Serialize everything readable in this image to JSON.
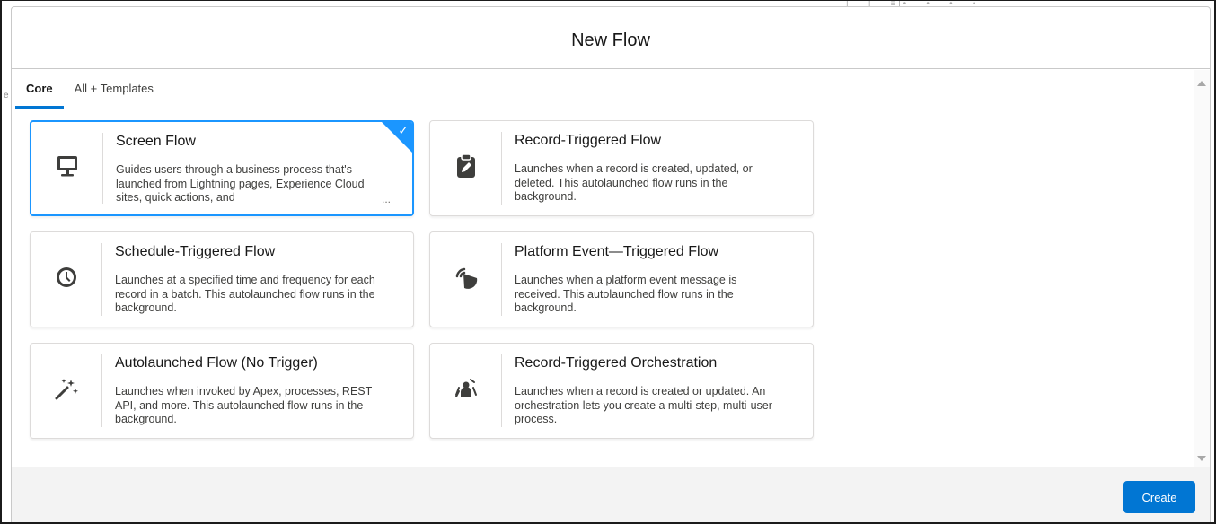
{
  "background": {
    "top_strip": "|  ___  |  ___  ≡  |  •  ___  •  ___  •  ___  •",
    "left_char": "e"
  },
  "modal": {
    "title": "New Flow"
  },
  "tabs": [
    {
      "label": "Core",
      "active": true
    },
    {
      "label": "All + Templates",
      "active": false
    }
  ],
  "cards": [
    {
      "title": "Screen Flow",
      "description": "Guides users through a business process that's launched from Lightning pages, Experience Cloud sites, quick actions, and",
      "ellipsis": "...",
      "icon": "monitor-icon",
      "selected": true
    },
    {
      "title": "Record-Triggered Flow",
      "description": "Launches when a record is created, updated, or deleted. This autolaunched flow runs in the background.",
      "icon": "clipboard-edit-icon",
      "selected": false
    },
    {
      "title": "Schedule-Triggered Flow",
      "description": "Launches at a specified time and frequency for each record in a batch. This autolaunched flow runs in the background.",
      "icon": "clock-icon",
      "selected": false
    },
    {
      "title": "Platform Event—Triggered Flow",
      "description": "Launches when a platform event message is received. This autolaunched flow runs in the background.",
      "icon": "broadcast-icon",
      "selected": false
    },
    {
      "title": "Autolaunched Flow (No Trigger)",
      "description": "Launches when invoked by Apex, processes, REST API, and more. This autolaunched flow runs in the background.",
      "icon": "magic-wand-icon",
      "selected": false
    },
    {
      "title": "Record-Triggered Orchestration",
      "description": "Launches when a record is created or updated. An orchestration lets you create a multi-step, multi-user process.",
      "icon": "orchestration-icon",
      "selected": false
    }
  ],
  "footer": {
    "create_label": "Create"
  },
  "colors": {
    "accent": "#0176d3",
    "selected_border": "#1b96ff",
    "icon_color": "#3e3e3c"
  }
}
